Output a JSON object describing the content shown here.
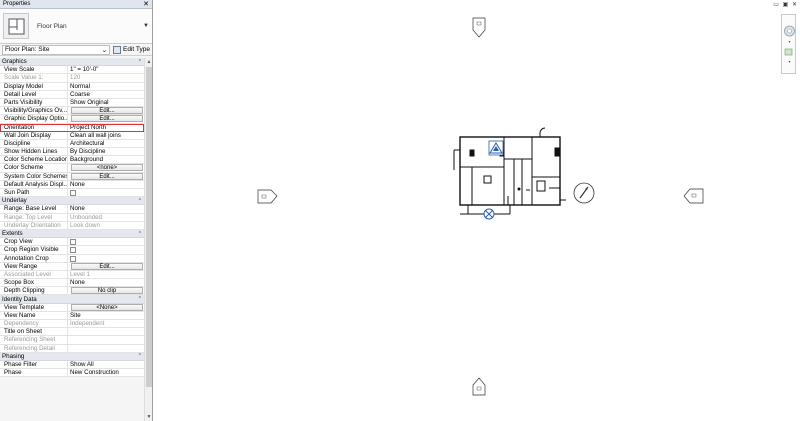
{
  "panel": {
    "title": "Properties",
    "close": "✕",
    "type_name": "Floor Plan",
    "view_selector": "Floor Plan: Site",
    "edit_type": "Edit Type"
  },
  "groups": [
    {
      "label": "Graphics",
      "rows": [
        {
          "k": "View Scale",
          "v": "1\" = 10'-0\""
        },
        {
          "k": "Scale Value    1:",
          "v": "120",
          "dim": true
        },
        {
          "k": "Display Model",
          "v": "Normal"
        },
        {
          "k": "Detail Level",
          "v": "Coarse"
        },
        {
          "k": "Parts Visibility",
          "v": "Show Original"
        },
        {
          "k": "Visibility/Graphics Ov...",
          "v": "Edit...",
          "btn": true
        },
        {
          "k": "Graphic Display Optio...",
          "v": "Edit...",
          "btn": true
        },
        {
          "k": "Orientation",
          "v": "Project North",
          "hl": true
        },
        {
          "k": "Wall Join Display",
          "v": "Clean all wall joins"
        },
        {
          "k": "Discipline",
          "v": "Architectural"
        },
        {
          "k": "Show Hidden Lines",
          "v": "By Discipline"
        },
        {
          "k": "Color Scheme Location",
          "v": "Background"
        },
        {
          "k": "Color Scheme",
          "v": "<none>",
          "btn": true
        },
        {
          "k": "System Color Schemes",
          "v": "Edit...",
          "btn": true
        },
        {
          "k": "Default Analysis Displ...",
          "v": "None"
        },
        {
          "k": "Sun Path",
          "v": "",
          "chk": true
        }
      ]
    },
    {
      "label": "Underlay",
      "rows": [
        {
          "k": "Range: Base Level",
          "v": "None"
        },
        {
          "k": "Range: Top Level",
          "v": "Unbounded",
          "dim": true
        },
        {
          "k": "Underlay Orientation",
          "v": "Look down",
          "dim": true
        }
      ]
    },
    {
      "label": "Extents",
      "rows": [
        {
          "k": "Crop View",
          "v": "",
          "chk": true
        },
        {
          "k": "Crop Region Visible",
          "v": "",
          "chk": true
        },
        {
          "k": "Annotation Crop",
          "v": "",
          "chk": true
        },
        {
          "k": "View Range",
          "v": "Edit...",
          "btn": true
        },
        {
          "k": "Associated Level",
          "v": "Level 1",
          "dim": true
        },
        {
          "k": "Scope Box",
          "v": "None"
        },
        {
          "k": "Depth Clipping",
          "v": "No clip",
          "btn": true
        }
      ]
    },
    {
      "label": "Identity Data",
      "rows": [
        {
          "k": "View Template",
          "v": "<None>",
          "btn": true
        },
        {
          "k": "View Name",
          "v": "Site"
        },
        {
          "k": "Dependency",
          "v": "Independent",
          "dim": true
        },
        {
          "k": "Title on Sheet",
          "v": ""
        },
        {
          "k": "Referencing Sheet",
          "v": "",
          "dim": true
        },
        {
          "k": "Referencing Detail",
          "v": "",
          "dim": true
        }
      ]
    },
    {
      "label": "Phasing",
      "rows": [
        {
          "k": "Phase Filter",
          "v": "Show All"
        },
        {
          "k": "Phase",
          "v": "New Construction"
        }
      ]
    }
  ],
  "window_controls": "▭ ▣ ✕"
}
